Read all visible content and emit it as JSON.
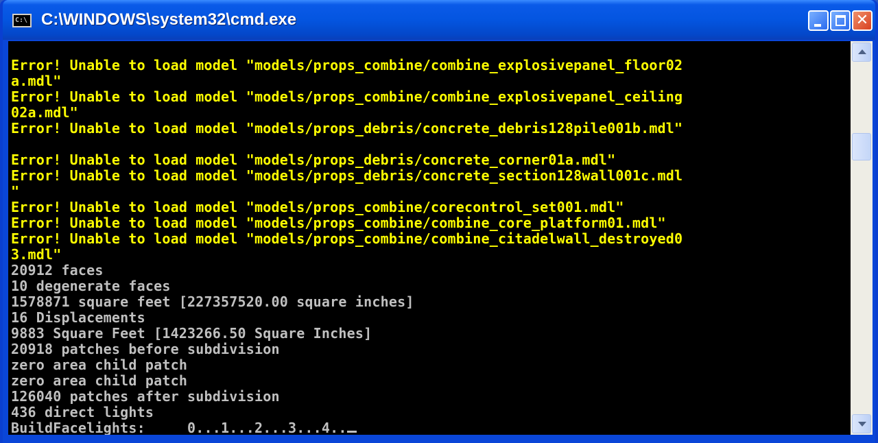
{
  "window": {
    "title": "C:\\WINDOWS\\system32\\cmd.exe",
    "icon": "cmd-console-icon",
    "icon_text": "C:\\",
    "minimize_glyph": "_",
    "maximize_glyph": "□",
    "close_glyph": "✕"
  },
  "colors": {
    "console_bg": "#000000",
    "error_text": "#ffff00",
    "normal_text": "#c0c0c0",
    "titlebar": "#0455e0"
  },
  "console": {
    "lines": [
      {
        "text": "Error! Unable to load model \"models/props_combine/combine_explosivepanel_floor02",
        "color": "yellow"
      },
      {
        "text": "a.mdl\"",
        "color": "yellow"
      },
      {
        "text": "Error! Unable to load model \"models/props_combine/combine_explosivepanel_ceiling",
        "color": "yellow"
      },
      {
        "text": "02a.mdl\"",
        "color": "yellow"
      },
      {
        "text": "Error! Unable to load model \"models/props_debris/concrete_debris128pile001b.mdl\"",
        "color": "yellow"
      },
      {
        "text": "",
        "color": "yellow"
      },
      {
        "text": "Error! Unable to load model \"models/props_debris/concrete_corner01a.mdl\"",
        "color": "yellow"
      },
      {
        "text": "Error! Unable to load model \"models/props_debris/concrete_section128wall001c.mdl",
        "color": "yellow"
      },
      {
        "text": "\"",
        "color": "yellow"
      },
      {
        "text": "Error! Unable to load model \"models/props_combine/corecontrol_set001.mdl\"",
        "color": "yellow"
      },
      {
        "text": "Error! Unable to load model \"models/props_combine/combine_core_platform01.mdl\"",
        "color": "yellow"
      },
      {
        "text": "Error! Unable to load model \"models/props_combine/combine_citadelwall_destroyed0",
        "color": "yellow"
      },
      {
        "text": "3.mdl\"",
        "color": "yellow"
      },
      {
        "text": "20912 faces",
        "color": "gray"
      },
      {
        "text": "10 degenerate faces",
        "color": "gray"
      },
      {
        "text": "1578871 square feet [227357520.00 square inches]",
        "color": "gray"
      },
      {
        "text": "16 Displacements",
        "color": "gray"
      },
      {
        "text": "9883 Square Feet [1423266.50 Square Inches]",
        "color": "gray"
      },
      {
        "text": "20918 patches before subdivision",
        "color": "gray"
      },
      {
        "text": "zero area child patch",
        "color": "gray"
      },
      {
        "text": "zero area child patch",
        "color": "gray"
      },
      {
        "text": "126040 patches after subdivision",
        "color": "gray"
      },
      {
        "text": "436 direct lights",
        "color": "gray"
      },
      {
        "text": "BuildFacelights:     0...1...2...3...4..",
        "color": "gray"
      }
    ]
  },
  "scrollbar": {
    "position_fraction": 0.22
  }
}
